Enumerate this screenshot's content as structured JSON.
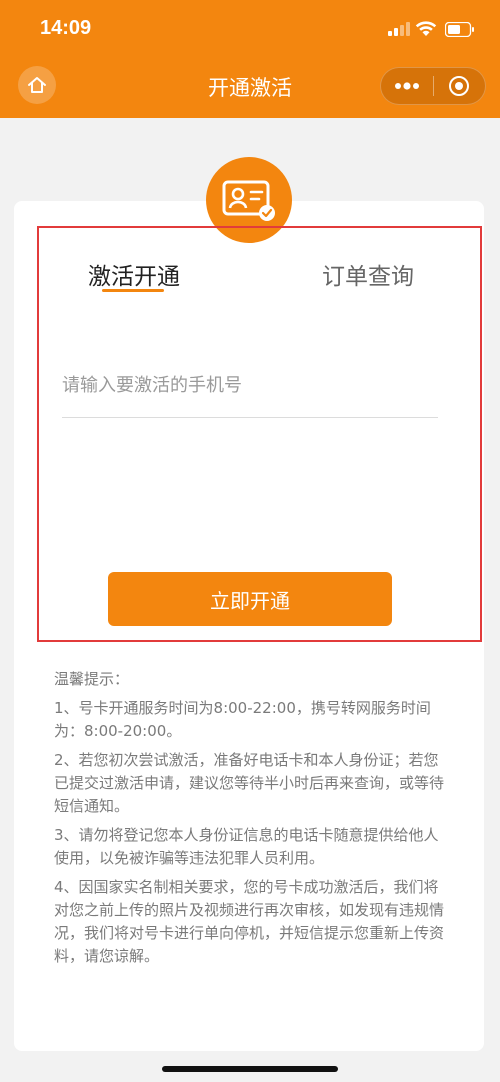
{
  "status_bar": {
    "time": "14:09"
  },
  "nav": {
    "title": "开通激活"
  },
  "tabs": [
    {
      "label": "激活开通",
      "active": true
    },
    {
      "label": "订单查询",
      "active": false
    }
  ],
  "form": {
    "phone_placeholder": "请输入要激活的手机号",
    "submit_label": "立即开通"
  },
  "tips": {
    "title": "温馨提示：",
    "items": [
      "1、号卡开通服务时间为8:00-22:00，携号转网服务时间为：8:00-20:00。",
      "2、若您初次尝试激活，准备好电话卡和本人身份证；若您已提交过激活申请，建议您等待半小时后再来查询，或等待短信通知。",
      "3、请勿将登记您本人身份证信息的电话卡随意提供给他人使用，以免被诈骗等违法犯罪人员利用。",
      "4、因国家实名制相关要求，您的号卡成功激活后，我们将对您之前上传的照片及视频进行再次审核，如发现有违规情况，我们将对号卡进行单向停机，并短信提示您重新上传资料，请您谅解。"
    ]
  },
  "icons": {
    "home": "home-icon",
    "more": "more-dots-icon",
    "close": "target-close-icon",
    "id_card": "id-card-icon",
    "signal": "signal-icon",
    "wifi": "wifi-icon",
    "battery": "battery-icon"
  },
  "colors": {
    "brand": "#f3860f",
    "highlight_border": "#e23b3b"
  }
}
